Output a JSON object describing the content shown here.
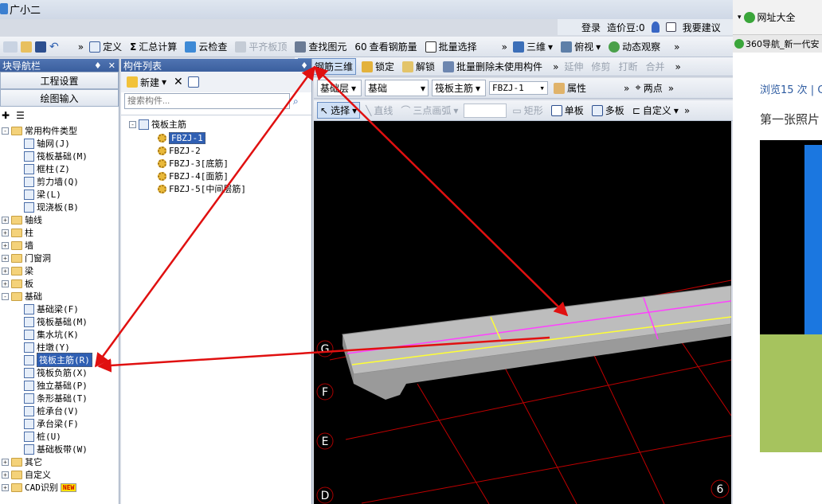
{
  "app": {
    "title": "广小二"
  },
  "topbar": {
    "login": "登录",
    "price": "造价豆:0",
    "suggest": "我要建议"
  },
  "toolbar1": {
    "define": "定义",
    "sum": "汇总计算",
    "cloud_check": "云检查",
    "flat_top": "平齐板顶",
    "find": "查找图元",
    "view_rebar": "查看钢筋量",
    "batch_select": "批量选择",
    "view3d": "三维",
    "top_view": "俯视",
    "dynamic": "动态观察"
  },
  "toolbar2": {
    "rebar3d": "钢筋三维",
    "lock": "锁定",
    "unlock": "解锁",
    "batch_delete": "批量删除未使用构件",
    "extend": "延伸",
    "trim": "修剪",
    "break": "打断",
    "merge": "合并"
  },
  "toolbar3": {
    "layer": "基础层",
    "category": "基础",
    "type": "筏板主筋",
    "component": "FBZJ-1",
    "attr": "属性",
    "two_points": "两点"
  },
  "toolbar4": {
    "select": "选择",
    "line": "直线",
    "arc": "三点画弧",
    "rect": "矩形",
    "single_board": "单板",
    "multi_board": "多板",
    "custom": "自定义"
  },
  "nav": {
    "header": "块导航栏",
    "project_settings": "工程设置",
    "drawing_input": "绘图输入",
    "tree": [
      {
        "label": "常用构件类型",
        "level": 0,
        "expand": "-",
        "folder": true
      },
      {
        "label": "轴网(J)",
        "level": 1
      },
      {
        "label": "筏板基础(M)",
        "level": 1
      },
      {
        "label": "框柱(Z)",
        "level": 1
      },
      {
        "label": "剪力墙(Q)",
        "level": 1
      },
      {
        "label": "梁(L)",
        "level": 1
      },
      {
        "label": "现浇板(B)",
        "level": 1
      },
      {
        "label": "轴线",
        "level": 0,
        "expand": "+",
        "folder": true
      },
      {
        "label": "柱",
        "level": 0,
        "expand": "+",
        "folder": true
      },
      {
        "label": "墙",
        "level": 0,
        "expand": "+",
        "folder": true
      },
      {
        "label": "门窗洞",
        "level": 0,
        "expand": "+",
        "folder": true
      },
      {
        "label": "梁",
        "level": 0,
        "expand": "+",
        "folder": true
      },
      {
        "label": "板",
        "level": 0,
        "expand": "+",
        "folder": true
      },
      {
        "label": "基础",
        "level": 0,
        "expand": "-",
        "folder": true
      },
      {
        "label": "基础梁(F)",
        "level": 1
      },
      {
        "label": "筏板基础(M)",
        "level": 1
      },
      {
        "label": "集水坑(K)",
        "level": 1
      },
      {
        "label": "柱墩(Y)",
        "level": 1
      },
      {
        "label": "筏板主筋(R)",
        "level": 1,
        "selected": true
      },
      {
        "label": "筏板负筋(X)",
        "level": 1
      },
      {
        "label": "独立基础(P)",
        "level": 1
      },
      {
        "label": "条形基础(T)",
        "level": 1
      },
      {
        "label": "桩承台(V)",
        "level": 1
      },
      {
        "label": "承台梁(F)",
        "level": 1
      },
      {
        "label": "桩(U)",
        "level": 1
      },
      {
        "label": "基础板带(W)",
        "level": 1
      },
      {
        "label": "其它",
        "level": 0,
        "expand": "+",
        "folder": true
      },
      {
        "label": "自定义",
        "level": 0,
        "expand": "+",
        "folder": true
      },
      {
        "label": "CAD识别",
        "level": 0,
        "expand": "+",
        "folder": true,
        "badge": "NEW"
      }
    ]
  },
  "components": {
    "header": "构件列表",
    "new": "新建",
    "search_placeholder": "搜索构件...",
    "root": "筏板主筋",
    "items": [
      "FBZJ-1",
      "FBZJ-2",
      "FBZJ-3[底筋]",
      "FBZJ-4[面筋]",
      "FBZJ-5[中间层筋]"
    ]
  },
  "canvas": {
    "axes": [
      "G",
      "F",
      "E",
      "D"
    ],
    "axis_num": "6"
  },
  "browser": {
    "nav_sites": "网址大全",
    "tab": "360导航_新一代安",
    "views": "浏览15 次 | C",
    "caption": "第一张照片"
  },
  "colors": {
    "accent": "#3b5f9e",
    "arrow": "#e01010",
    "magenta": "#ff40ff",
    "yellow": "#ffff33",
    "grid": "#c00000"
  }
}
